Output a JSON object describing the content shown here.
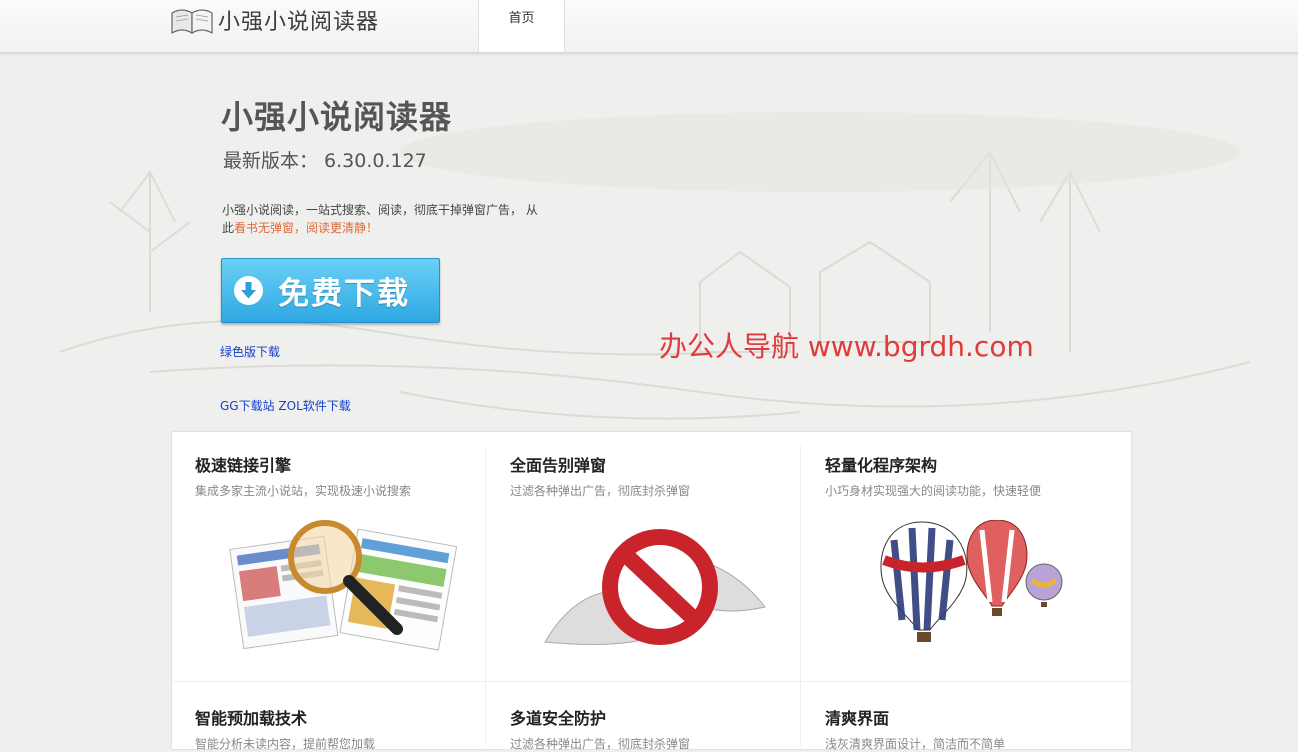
{
  "header": {
    "logo_text": "小强小说阅读器",
    "logo_icon": "book-icon",
    "nav": [
      {
        "label": "首页"
      }
    ]
  },
  "hero": {
    "title": "小强小说阅读器",
    "version_label": "最新版本：",
    "version_value": "6.30.0.127",
    "description": "小强小说阅读，一站式搜索、阅读，彻底干掉弹窗广告， 从此",
    "description_highlight": "看书无弹窗，阅读更清静！",
    "download_button": "免费下载",
    "download_icon": "download-arrow-icon",
    "green_link": "绿色版下载",
    "mirror_links": "GG下载站 ZOL软件下载"
  },
  "watermark": "办公人导航 www.bgrdh.com",
  "features": [
    {
      "title": "极速链接引擎",
      "desc": "集成多家主流小说站，实现极速小说搜索",
      "image": "magnifier-newspapers-image"
    },
    {
      "title": "全面告别弹窗",
      "desc": "过滤各种弹出广告，彻底封杀弹窗",
      "image": "no-popup-sign-image"
    },
    {
      "title": "轻量化程序架构",
      "desc": "小巧身材实现强大的阅读功能，快速轻便",
      "image": "hot-air-balloons-image"
    },
    {
      "title": "智能预加载技术",
      "desc": "智能分析未读内容，提前帮您加载"
    },
    {
      "title": "多道安全防护",
      "desc": "过滤各种弹出广告，彻底封杀弹窗"
    },
    {
      "title": "清爽界面",
      "desc": "浅灰清爽界面设计，简洁而不简单"
    }
  ],
  "colors": {
    "button": "#2ea8e3",
    "link": "#1540c8",
    "highlight": "#e06a3a",
    "watermark": "#e03b3b"
  }
}
